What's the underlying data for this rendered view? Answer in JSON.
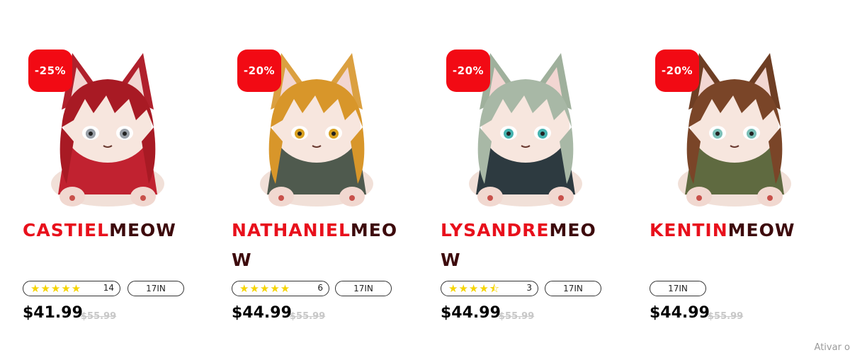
{
  "products": [
    {
      "discount": "-25%",
      "title_a": "CASTIEL",
      "title_b": "MEOW",
      "stars": "★★★★★",
      "reviews": "14",
      "size": "17IN",
      "price": "$41.99",
      "old_price": "$55.99",
      "colors": {
        "hair": "#a81a24",
        "ears": "#b0202c",
        "body": "#c12230",
        "eyes": "#9aa0a8"
      }
    },
    {
      "discount": "-20%",
      "title_a": "NATHANIEL",
      "title_b": "MEOW",
      "stars": "★★★★★",
      "reviews": "6",
      "size": "17IN",
      "price": "$44.99",
      "old_price": "$55.99",
      "colors": {
        "hair": "#d8962a",
        "ears": "#dba040",
        "body": "#4f5a4e",
        "eyes": "#d8a020"
      }
    },
    {
      "discount": "-20%",
      "title_a": "LYSANDRE",
      "title_b": "MEOW",
      "stars": "★★★★⯪",
      "reviews": "3",
      "size": "17IN",
      "price": "$44.99",
      "old_price": "$55.99",
      "colors": {
        "hair": "#a8b8a6",
        "ears": "#9fb09c",
        "body": "#2d3a40",
        "eyes": "#46b3b0"
      }
    },
    {
      "discount": "-20%",
      "title_a": "KENTIN",
      "title_b": "MEOW",
      "size": "17IN",
      "price": "$44.99",
      "old_price": "$55.99",
      "colors": {
        "hair": "#7a4528",
        "ears": "#6e3e24",
        "body": "#5f6a40",
        "eyes": "#7cc0b8"
      }
    }
  ],
  "footer": {
    "activate": "Ativar o"
  }
}
